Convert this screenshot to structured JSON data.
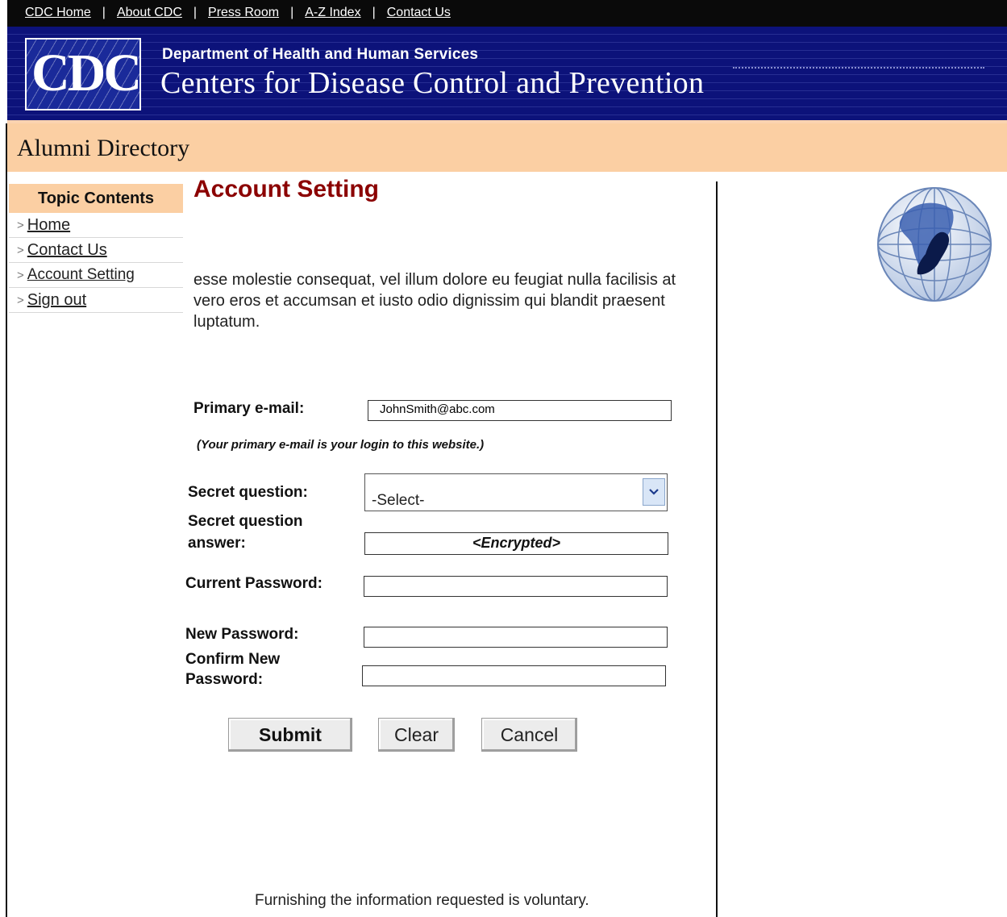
{
  "top_links": [
    "CDC Home",
    "About CDC",
    "Press Room",
    "A-Z Index",
    "Contact Us"
  ],
  "top_separator": "|",
  "banner": {
    "logo_text": "CDC",
    "department": "Department of Health and Human Services",
    "agency": "Centers for Disease Control and Prevention"
  },
  "section_title": "Alumni Directory",
  "nav": {
    "heading": "Topic Contents",
    "arrow": ">",
    "items": [
      "Home",
      "Contact Us",
      "Account Setting",
      "Sign out"
    ]
  },
  "main": {
    "title": "Account Setting",
    "intro": "esse molestie consequat, vel illum dolore eu feugiat nulla facilisis at vero eros et accumsan et iusto odio dignissim qui blandit praesent luptatum.",
    "form": {
      "primary_email_label": "Primary e-mail:",
      "primary_email_value": "JohnSmith@abc.com",
      "primary_email_hint": "(Your primary e-mail is your login to this website.)",
      "secret_question_label": "Secret question:",
      "secret_question_value": "-Select-",
      "secret_answer_label_1": "Secret question",
      "secret_answer_label_2": "answer:",
      "secret_answer_value": "<Encrypted>",
      "current_password_label": "Current Password:",
      "new_password_label": "New Password:",
      "confirm_password_label_1": "Confirm New",
      "confirm_password_label_2": "Password:"
    },
    "buttons": {
      "submit": "Submit",
      "clear": "Clear",
      "cancel": "Cancel"
    },
    "footer_note": "Furnishing the information requested is voluntary."
  },
  "colors": {
    "banner_blue": "#0c127a",
    "peach": "#fbcfa3",
    "title_red": "#8b0000"
  },
  "icons": [
    "globe-icon",
    "dropdown-arrow-icon"
  ]
}
